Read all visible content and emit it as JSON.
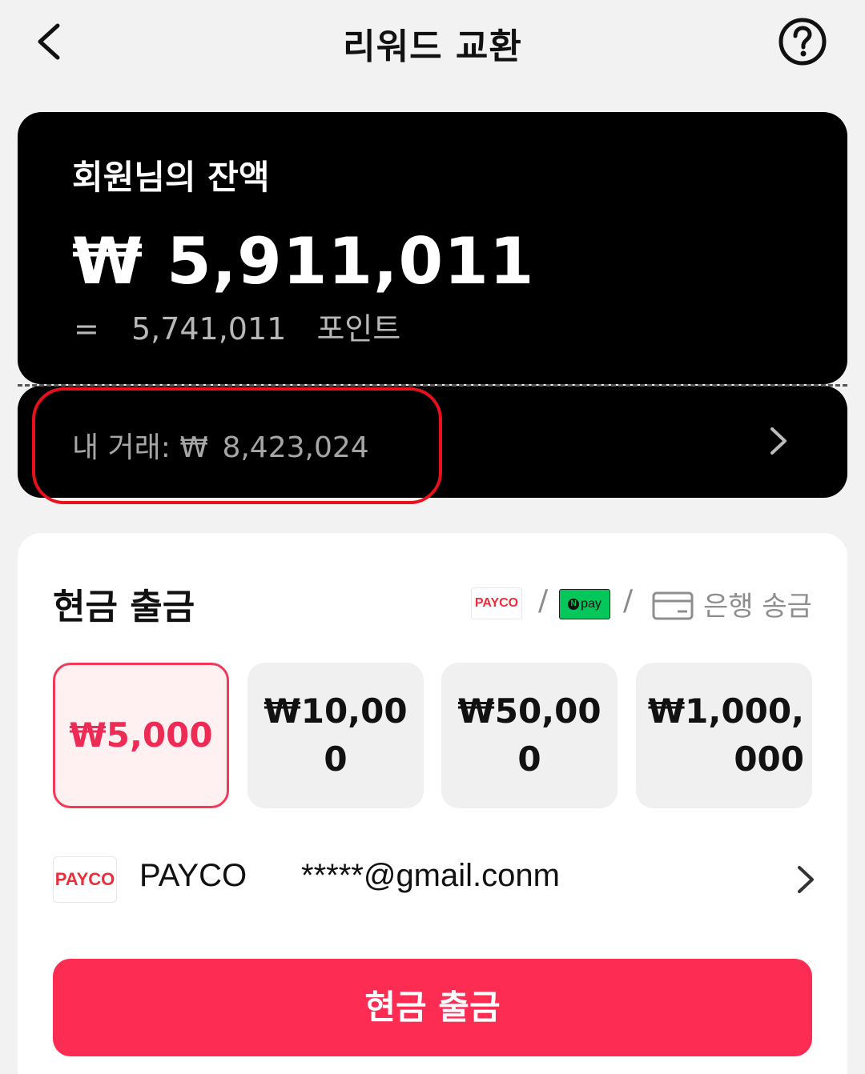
{
  "header": {
    "title": "리워드 교환"
  },
  "balance": {
    "label": "회원님의 잔액",
    "amount": "₩ 5,911,011",
    "points_eq": "=",
    "points_value": "5,741,011",
    "points_unit": "포인트"
  },
  "transactions": {
    "label": "내 거래: ₩",
    "amount": "8,423,024"
  },
  "withdraw": {
    "title": "현금 출금",
    "methods": {
      "payco": "PAYCO",
      "slash": "/",
      "npay": "pay",
      "npay_n": "N",
      "bank": "은행 송금"
    },
    "options": [
      {
        "label": "₩5,000",
        "selected": true
      },
      {
        "label": "₩10,000",
        "selected": false
      },
      {
        "label": "₩50,000",
        "selected": false
      },
      {
        "label": "₩1,000,000",
        "selected": false
      }
    ],
    "account": {
      "logo": "PAYCO",
      "name": "PAYCO",
      "email": "*****@gmail.conm"
    },
    "button_label": "현금 출금"
  },
  "colors": {
    "accent": "#fd2c53",
    "selected_text": "#ee2b54",
    "highlight_ring": "#e8101a",
    "npay_green": "#03c75a",
    "payco_red": "#ee2d3a"
  }
}
